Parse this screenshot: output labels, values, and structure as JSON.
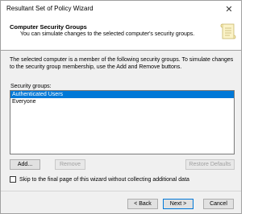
{
  "window": {
    "title": "Resultant Set of Policy Wizard",
    "close_glyph": "✕"
  },
  "header": {
    "title": "Computer Security Groups",
    "description": "You can simulate changes to the selected computer's security groups.",
    "icon": "scroll-icon"
  },
  "body": {
    "description": "The selected computer is a member of the following security groups. To simulate changes to the security group membership, use the Add and Remove buttons.",
    "groups_label": "Security groups:",
    "groups": [
      {
        "name": "Authenticated Users",
        "selected": true
      },
      {
        "name": "Everyone",
        "selected": false
      }
    ]
  },
  "buttons": {
    "add": "Add...",
    "remove": "Remove",
    "restore_defaults": "Restore Defaults"
  },
  "skip": {
    "label": "Skip to the final page of this wizard without collecting additional data",
    "checked": false
  },
  "nav": {
    "back": "< Back",
    "next": "Next >",
    "cancel": "Cancel"
  },
  "colors": {
    "selection": "#0078d7",
    "dialog_bg": "#f0f0f0"
  }
}
